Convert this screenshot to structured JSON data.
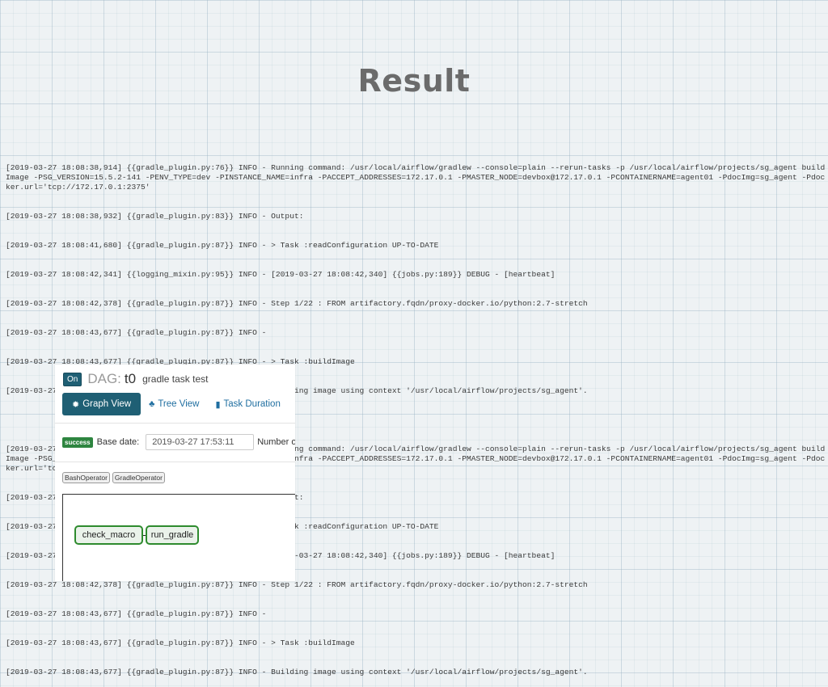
{
  "slide": {
    "title": "Result"
  },
  "log": [
    "[2019-03-27 18:08:38,914] {{gradle_plugin.py:76}} INFO - Running command: /usr/local/airflow/gradlew --console=plain --rerun-tasks -p /usr/local/airflow/projects/sg_agent buildImage -PSG_VERSION=15.5.2-141 -PENV_TYPE=dev -PINSTANCE_NAME=infra -PACCEPT_ADDRESSES=172.17.0.1 -PMASTER_NODE=devbox@172.17.0.1 -PCONTAINERNAME=agent01 -PdocImg=sg_agent -Pdocker.url='tcp://172.17.0.1:2375'",
    "[2019-03-27 18:08:38,932] {{gradle_plugin.py:83}} INFO - Output:",
    "[2019-03-27 18:08:41,680] {{gradle_plugin.py:87}} INFO - > Task :readConfiguration UP-TO-DATE",
    "[2019-03-27 18:08:42,341] {{logging_mixin.py:95}} INFO - [2019-03-27 18:08:42,340] {{jobs.py:189}} DEBUG - [heartbeat]",
    "[2019-03-27 18:08:42,378] {{gradle_plugin.py:87}} INFO - Step 1/22 : FROM artifactory.fqdn/proxy-docker.io/python:2.7-stretch",
    "[2019-03-27 18:08:43,677] {{gradle_plugin.py:87}} INFO -",
    "[2019-03-27 18:08:43,677] {{gradle_plugin.py:87}} INFO - > Task :buildImage",
    "[2019-03-27 18:08:43,677] {{gradle_plugin.py:87}} INFO - Building image using context '/usr/local/airflow/projects/sg_agent'.",
    "",
    "[2019-03-27 18:08:38,914] {{gradle_plugin.py:76}} INFO - Running command: /usr/local/airflow/gradlew --console=plain --rerun-tasks -p /usr/local/airflow/projects/sg_agent buildImage -PSG_VERSION=15.5.2-141 -PENV_TYPE=dev -PINSTANCE_NAME=infra -PACCEPT_ADDRESSES=172.17.0.1 -PMASTER_NODE=devbox@172.17.0.1 -PCONTAINERNAME=agent01 -PdocImg=sg_agent -Pdocker.url='tcp://172.17.0.1:2375'",
    "[2019-03-27 18:08:38,932] {{gradle_plugin.py:83}} INFO - Output:",
    "[2019-03-27 18:08:41,680] {{gradle_plugin.py:87}} INFO - > Task :readConfiguration UP-TO-DATE",
    "[2019-03-27 18:08:42,341] {{logging_mixin.py:95}} INFO - [2019-03-27 18:08:42,340] {{jobs.py:189}} DEBUG - [heartbeat]",
    "[2019-03-27 18:08:42,378] {{gradle_plugin.py:87}} INFO - Step 1/22 : FROM artifactory.fqdn/proxy-docker.io/python:2.7-stretch",
    "[2019-03-27 18:08:43,677] {{gradle_plugin.py:87}} INFO -",
    "[2019-03-27 18:08:43,677] {{gradle_plugin.py:87}} INFO - > Task :buildImage",
    "[2019-03-27 18:08:43,677] {{gradle_plugin.py:87}} INFO - Building image using context '/usr/local/airflow/projects/sg_agent'."
  ],
  "airflow": {
    "toggle_label": "On",
    "dag_label": "DAG:",
    "dag_id": "t0",
    "dag_description": "gradle task test",
    "tabs": [
      {
        "label": "Graph View",
        "icon": "sun-icon"
      },
      {
        "label": "Tree View",
        "icon": "tree-icon"
      },
      {
        "label": "Task Duration",
        "icon": "bar-chart-icon"
      }
    ],
    "status_badge": "success",
    "base_date_label": "Base date:",
    "base_date_value": "2019-03-27 17:53:11",
    "number_label": "Number of",
    "operators": [
      "BashOperator",
      "GradleOperator"
    ],
    "nodes": [
      "check_macro",
      "run_gradle"
    ],
    "colors": {
      "accent": "#1f5f74",
      "success": "#2e8540",
      "node_border": "#2e8b2e"
    }
  }
}
